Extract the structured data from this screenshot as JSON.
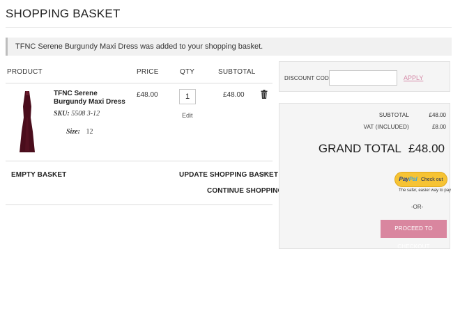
{
  "page": {
    "title": "SHOPPING BASKET"
  },
  "notice": {
    "text": "TFNC Serene Burgundy Maxi Dress was added to your shopping basket."
  },
  "table": {
    "headers": {
      "product": "PRODUCT",
      "price": "PRICE",
      "qty": "QTY",
      "subtotal": "SUBTOTAL"
    },
    "items": [
      {
        "name": "TFNC Serene Burgundy Maxi Dress",
        "sku_label": "SKU:",
        "sku": "5508 3-12",
        "size_label": "Size:",
        "size": "12",
        "price": "£48.00",
        "qty": "1",
        "edit_label": "Edit",
        "subtotal": "£48.00",
        "image_color": "#4a0d1c",
        "remove_icon": "trash-icon"
      }
    ]
  },
  "actions": {
    "empty_basket": "EMPTY BASKET",
    "update_basket": "UPDATE SHOPPING BASKET",
    "or_small": "-OR-",
    "continue_shopping": "CONTINUE SHOPPING"
  },
  "discount": {
    "label": "DISCOUNT CODES",
    "value": "",
    "apply_label": "APPLY"
  },
  "totals": {
    "subtotal_label": "SUBTOTAL",
    "subtotal_value": "£48.00",
    "vat_label": "VAT (INCLUDED)",
    "vat_value": "£8.00",
    "grand_label": "GRAND TOTAL",
    "grand_value": "£48.00"
  },
  "paypal": {
    "brand_pay": "Pay",
    "brand_pal": "Pal",
    "check_out": "Check out",
    "tagline": "The safer, easier way to pay"
  },
  "checkout": {
    "or": "-OR-",
    "button": "PROCEED TO CHECKOUT"
  },
  "colors": {
    "accent": "#d9869f",
    "apply_link": "#d58aa8",
    "paypal_yellow": "#f6c334"
  }
}
